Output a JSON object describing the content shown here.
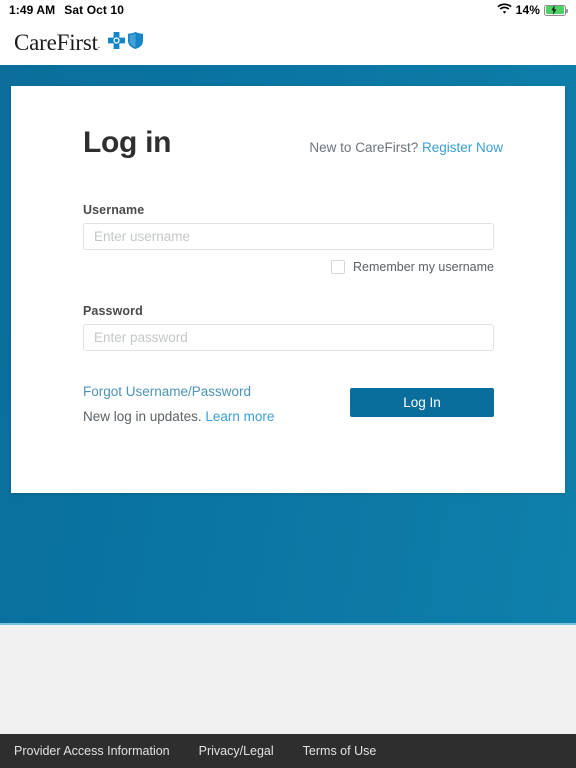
{
  "status_bar": {
    "time": "1:49 AM",
    "date": "Sat Oct 10",
    "wifi_icon": "wifi-icon",
    "battery_percent": "14%",
    "battery_icon": "battery-charging-icon"
  },
  "brand": {
    "name": "CareFirst",
    "trademark": ".",
    "cross_icon": "blue-cross-icon",
    "shield_icon": "blue-shield-icon"
  },
  "login_card": {
    "title": "Log in",
    "new_user_prompt": "New to CareFirst?",
    "register_link": "Register Now",
    "username": {
      "label": "Username",
      "placeholder": "Enter username",
      "value": ""
    },
    "remember": {
      "label": "Remember my username",
      "checked": false
    },
    "password": {
      "label": "Password",
      "placeholder": "Enter password",
      "value": ""
    },
    "forgot_link": "Forgot Username/Password",
    "updates_text": "New log in updates.",
    "learn_more_link": "Learn more",
    "submit_label": "Log In"
  },
  "footer": {
    "links": [
      {
        "label": "Provider Access Information"
      },
      {
        "label": "Privacy/Legal"
      },
      {
        "label": "Terms of Use"
      }
    ]
  },
  "colors": {
    "hero_blue": "#0a74a2",
    "hero_accent_line": "#74c4e2",
    "button_blue": "#0a6e9d",
    "link_blue": "#3b9ed6",
    "forgot_link_blue": "#4b93b5",
    "footer_bg": "#2e2e2e",
    "filler_gray": "#f1f1f1",
    "battery_green": "#4cd264"
  }
}
